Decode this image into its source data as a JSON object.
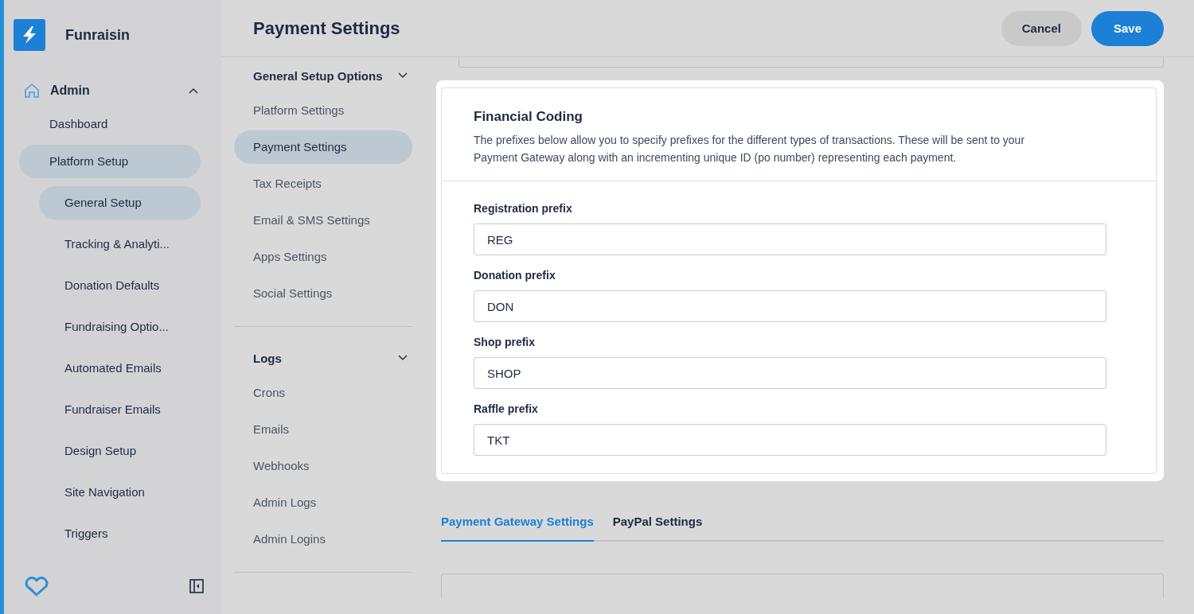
{
  "app": {
    "name": "Funraisin"
  },
  "sidebar": {
    "items": [
      {
        "label": "Admin",
        "expanded": true,
        "children": [
          {
            "label": "Dashboard",
            "selected": false
          },
          {
            "label": "Platform Setup",
            "selected": true,
            "children": [
              {
                "label": "General Setup",
                "selected": true
              },
              {
                "label": "Tracking & Analyti...",
                "selected": false
              },
              {
                "label": "Donation Defaults",
                "selected": false
              },
              {
                "label": "Fundraising Optio...",
                "selected": false
              },
              {
                "label": "Automated Emails",
                "selected": false
              },
              {
                "label": "Fundraiser Emails",
                "selected": false
              },
              {
                "label": "Design Setup",
                "selected": false
              },
              {
                "label": "Site Navigation",
                "selected": false
              },
              {
                "label": "Triggers",
                "selected": false
              }
            ]
          }
        ]
      }
    ]
  },
  "header": {
    "title": "Payment Settings",
    "buttons": [
      {
        "label": "Cancel",
        "kind": "secondary"
      },
      {
        "label": "Save",
        "kind": "primary"
      }
    ]
  },
  "settings_nav": [
    {
      "title": "General Setup Options",
      "expanded": true,
      "items": [
        {
          "label": "Platform Settings",
          "selected": false
        },
        {
          "label": "Payment Settings",
          "selected": true
        },
        {
          "label": "Tax Receipts",
          "selected": false
        },
        {
          "label": "Email & SMS Settings",
          "selected": false
        },
        {
          "label": "Apps Settings",
          "selected": false
        },
        {
          "label": "Social Settings",
          "selected": false
        }
      ]
    },
    {
      "title": "Logs",
      "expanded": true,
      "items": [
        {
          "label": "Crons",
          "selected": false
        },
        {
          "label": "Emails",
          "selected": false
        },
        {
          "label": "Webhooks",
          "selected": false
        },
        {
          "label": "Admin Logs",
          "selected": false
        },
        {
          "label": "Admin Logins",
          "selected": false
        }
      ]
    }
  ],
  "financial_coding": {
    "title": "Financial Coding",
    "description": "The prefixes below allow you to specify prefixes for the different types of transactions. These will be sent to your Payment Gateway along with an incrementing unique ID (po number) representing each payment.",
    "fields": [
      {
        "label": "Registration prefix",
        "value": "REG"
      },
      {
        "label": "Donation prefix",
        "value": "DON"
      },
      {
        "label": "Shop prefix",
        "value": "SHOP"
      },
      {
        "label": "Raffle prefix",
        "value": "TKT"
      }
    ]
  },
  "tabs": [
    {
      "label": "Payment Gateway Settings",
      "selected": true
    },
    {
      "label": "PayPal Settings",
      "selected": false
    }
  ]
}
